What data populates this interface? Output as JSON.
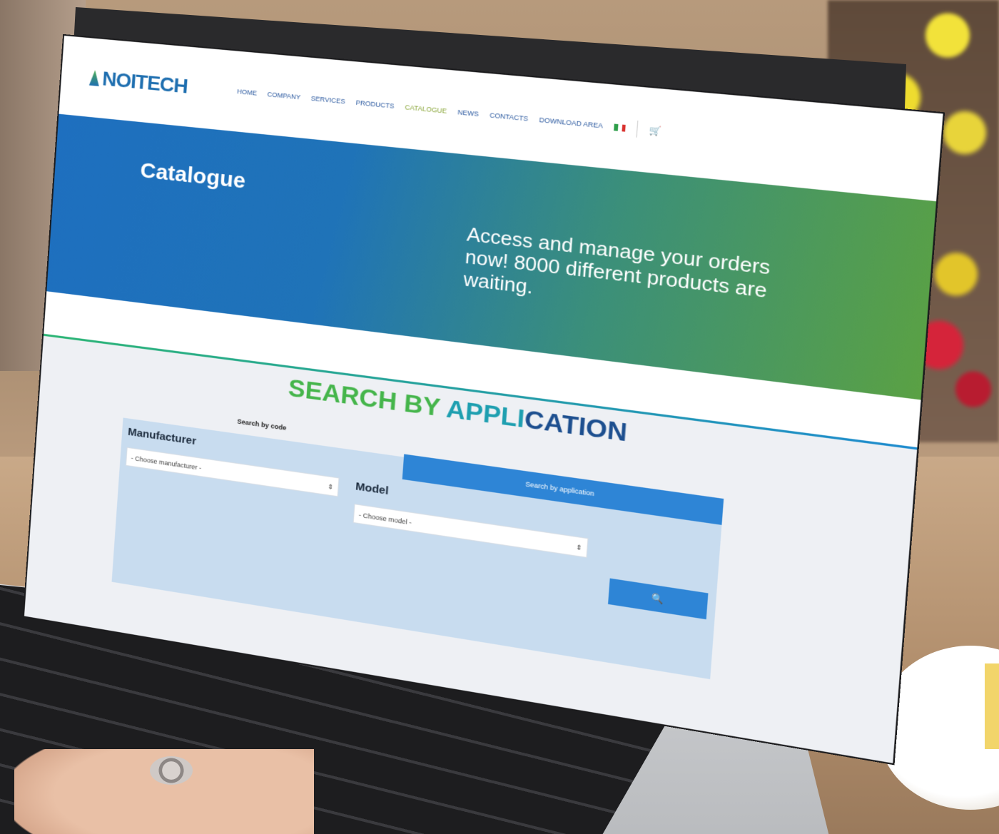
{
  "header": {
    "logo_text": "NOITECH",
    "nav": [
      "HOME",
      "COMPANY",
      "SERVICES",
      "PRODUCTS",
      "CATALOGUE",
      "NEWS",
      "CONTACTS",
      "DOWNLOAD AREA"
    ],
    "active_nav": "CATALOGUE",
    "cart_icon": "cart-icon",
    "flag_colors": [
      "#2e9e4a",
      "#ffffff",
      "#d9322f"
    ]
  },
  "hero": {
    "title": "Catalogue",
    "tagline": "Access and manage your orders now! 8000 different products are waiting."
  },
  "section": {
    "title_part1": "SEARCH BY ",
    "title_part2": "APPLI",
    "title_part3": "CATION"
  },
  "search": {
    "tab_code": "Search by code",
    "tab_application": "Search by application",
    "manufacturer_label": "Manufacturer",
    "manufacturer_placeholder": "- Choose manufacturer -",
    "model_label": "Model",
    "model_placeholder": "- Choose model -",
    "search_icon": "search-icon"
  },
  "colors": {
    "brand_blue": "#1f6fb0",
    "accent_green": "#45b54b",
    "button_blue": "#2e85d6"
  }
}
